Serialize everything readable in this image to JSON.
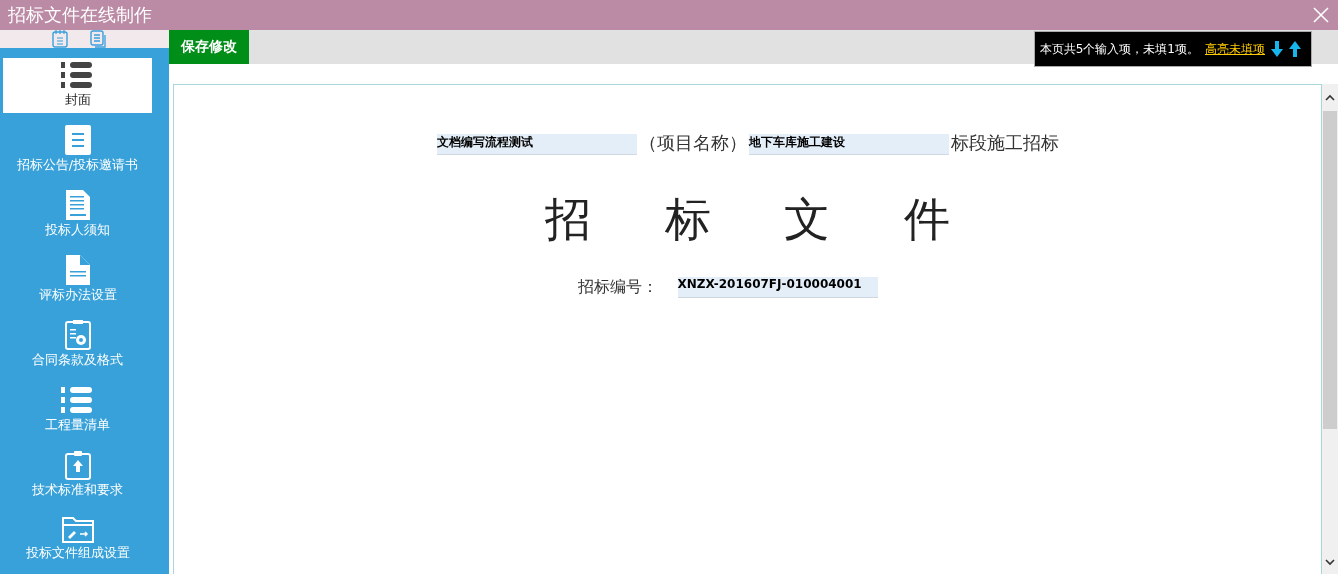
{
  "window": {
    "title": "招标文件在线制作"
  },
  "sidebar": {
    "items": [
      {
        "label": "封面",
        "kind": "numbered-list",
        "selected": true
      },
      {
        "label": "招标公告/投标邀请书",
        "kind": "lines-page",
        "selected": false
      },
      {
        "label": "投标人须知",
        "kind": "signed-page",
        "selected": false
      },
      {
        "label": "评标办法设置",
        "kind": "folded-page",
        "selected": false
      },
      {
        "label": "合同条款及格式",
        "kind": "gear-clipboard",
        "selected": false
      },
      {
        "label": "工程量清单",
        "kind": "numbered-list",
        "selected": false
      },
      {
        "label": "技术标准和要求",
        "kind": "upload-clipboard",
        "selected": false
      },
      {
        "label": "投标文件组成设置",
        "kind": "folder-edit",
        "selected": false
      }
    ]
  },
  "toolbar": {
    "save_button": "保存修改"
  },
  "notice": {
    "text": "本页共5个输入项，未填1项。",
    "link": "高亮未填项"
  },
  "document": {
    "project_field": "文档编写流程测试",
    "project_suffix": "（项目名称）",
    "section_field": "地下车库施工建设",
    "section_suffix": "标段施工招标",
    "heading": "招标文件",
    "number_label": "招标编号：",
    "number_field": "XNZX-201607FJ-010004001"
  }
}
